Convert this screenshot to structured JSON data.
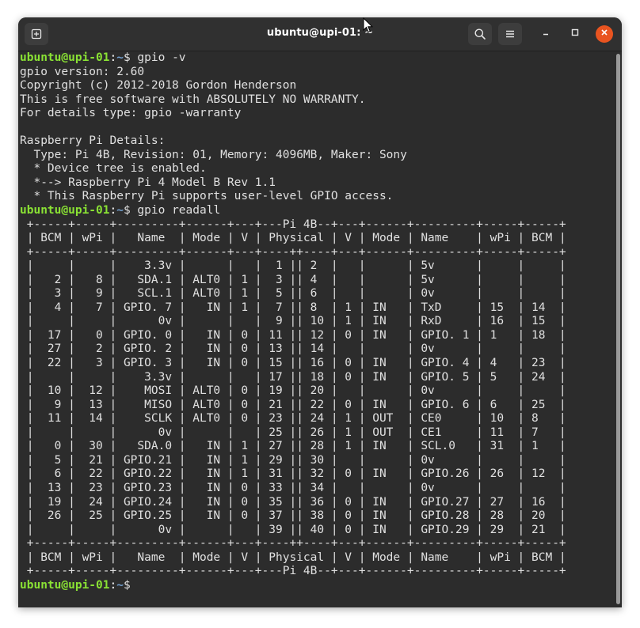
{
  "window": {
    "title": "ubuntu@upi-01: ~"
  },
  "icons": {
    "new_tab": "new-tab-icon",
    "search": "search-icon",
    "menu": "hamburger-menu-icon",
    "minimize": "minimize-icon",
    "maximize": "maximize-icon",
    "close": "close-icon"
  },
  "colors": {
    "prompt_user": "#8ae234",
    "prompt_path": "#729fcf",
    "close_button": "#e95420",
    "terminal_bg": "#2c2c2c"
  },
  "terminal": {
    "lines": [
      {
        "type": "prompt",
        "user": "ubuntu@upi-01",
        "sep": ":",
        "path": "~",
        "cmd": "$ gpio -v"
      },
      {
        "type": "text",
        "text": "gpio version: 2.60"
      },
      {
        "type": "text",
        "text": "Copyright (c) 2012-2018 Gordon Henderson"
      },
      {
        "type": "text",
        "text": "This is free software with ABSOLUTELY NO WARRANTY."
      },
      {
        "type": "text",
        "text": "For details type: gpio -warranty"
      },
      {
        "type": "text",
        "text": ""
      },
      {
        "type": "text",
        "text": "Raspberry Pi Details:"
      },
      {
        "type": "text",
        "text": "  Type: Pi 4B, Revision: 01, Memory: 4096MB, Maker: Sony"
      },
      {
        "type": "text",
        "text": "  * Device tree is enabled."
      },
      {
        "type": "text",
        "text": "  *--> Raspberry Pi 4 Model B Rev 1.1"
      },
      {
        "type": "text",
        "text": "  * This Raspberry Pi supports user-level GPIO access."
      },
      {
        "type": "prompt",
        "user": "ubuntu@upi-01",
        "sep": ":",
        "path": "~",
        "cmd": "$ gpio readall"
      },
      {
        "type": "text",
        "text": " +-----+-----+---------+------+---+---Pi 4B--+---+------+---------+-----+-----+"
      },
      {
        "type": "text",
        "text": " | BCM | wPi |   Name  | Mode | V | Physical | V | Mode | Name    | wPi | BCM |"
      },
      {
        "type": "text",
        "text": " +-----+-----+---------+------+---+----++----+---+------+---------+-----+-----+"
      },
      {
        "type": "text",
        "text": " |     |     |    3.3v |      |   |  1 || 2  |   |      | 5v      |     |     |"
      },
      {
        "type": "text",
        "text": " |   2 |   8 |   SDA.1 | ALT0 | 1 |  3 || 4  |   |      | 5v      |     |     |"
      },
      {
        "type": "text",
        "text": " |   3 |   9 |   SCL.1 | ALT0 | 1 |  5 || 6  |   |      | 0v      |     |     |"
      },
      {
        "type": "text",
        "text": " |   4 |   7 | GPIO. 7 |   IN | 1 |  7 || 8  | 1 | IN   | TxD     | 15  | 14  |"
      },
      {
        "type": "text",
        "text": " |     |     |      0v |      |   |  9 || 10 | 1 | IN   | RxD     | 16  | 15  |"
      },
      {
        "type": "text",
        "text": " |  17 |   0 | GPIO. 0 |   IN | 0 | 11 || 12 | 0 | IN   | GPIO. 1 | 1   | 18  |"
      },
      {
        "type": "text",
        "text": " |  27 |   2 | GPIO. 2 |   IN | 0 | 13 || 14 |   |      | 0v      |     |     |"
      },
      {
        "type": "text",
        "text": " |  22 |   3 | GPIO. 3 |   IN | 0 | 15 || 16 | 0 | IN   | GPIO. 4 | 4   | 23  |"
      },
      {
        "type": "text",
        "text": " |     |     |    3.3v |      |   | 17 || 18 | 0 | IN   | GPIO. 5 | 5   | 24  |"
      },
      {
        "type": "text",
        "text": " |  10 |  12 |    MOSI | ALT0 | 0 | 19 || 20 |   |      | 0v      |     |     |"
      },
      {
        "type": "text",
        "text": " |   9 |  13 |    MISO | ALT0 | 0 | 21 || 22 | 0 | IN   | GPIO. 6 | 6   | 25  |"
      },
      {
        "type": "text",
        "text": " |  11 |  14 |    SCLK | ALT0 | 0 | 23 || 24 | 1 | OUT  | CE0     | 10  | 8   |"
      },
      {
        "type": "text",
        "text": " |     |     |      0v |      |   | 25 || 26 | 1 | OUT  | CE1     | 11  | 7   |"
      },
      {
        "type": "text",
        "text": " |   0 |  30 |   SDA.0 |   IN | 1 | 27 || 28 | 1 | IN   | SCL.0   | 31  | 1   |"
      },
      {
        "type": "text",
        "text": " |   5 |  21 | GPIO.21 |   IN | 1 | 29 || 30 |   |      | 0v      |     |     |"
      },
      {
        "type": "text",
        "text": " |   6 |  22 | GPIO.22 |   IN | 1 | 31 || 32 | 0 | IN   | GPIO.26 | 26  | 12  |"
      },
      {
        "type": "text",
        "text": " |  13 |  23 | GPIO.23 |   IN | 0 | 33 || 34 |   |      | 0v      |     |     |"
      },
      {
        "type": "text",
        "text": " |  19 |  24 | GPIO.24 |   IN | 0 | 35 || 36 | 0 | IN   | GPIO.27 | 27  | 16  |"
      },
      {
        "type": "text",
        "text": " |  26 |  25 | GPIO.25 |   IN | 0 | 37 || 38 | 0 | IN   | GPIO.28 | 28  | 20  |"
      },
      {
        "type": "text",
        "text": " |     |     |      0v |      |   | 39 || 40 | 0 | IN   | GPIO.29 | 29  | 21  |"
      },
      {
        "type": "text",
        "text": " +-----+-----+---------+------+---+----++----+---+------+---------+-----+-----+"
      },
      {
        "type": "text",
        "text": " | BCM | wPi |   Name  | Mode | V | Physical | V | Mode | Name    | wPi | BCM |"
      },
      {
        "type": "text",
        "text": " +-----+-----+---------+------+---+---Pi 4B--+---+------+---------+-----+-----+"
      },
      {
        "type": "prompt",
        "user": "ubuntu@upi-01",
        "sep": ":",
        "path": "~",
        "cmd": "$ "
      }
    ]
  }
}
